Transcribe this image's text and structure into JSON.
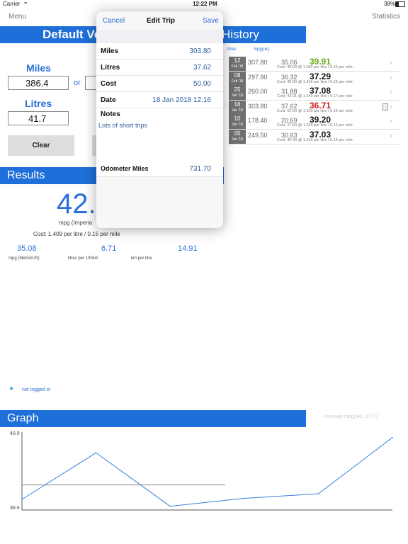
{
  "status": {
    "carrier": "Carrier",
    "time": "12:22 PM",
    "battery": "38%"
  },
  "topbar": {
    "menu": "Menu",
    "statistics": "Statistics"
  },
  "calculator": {
    "title": "Default Ve",
    "miles_label": "Miles",
    "miles_value": "386.4",
    "or_label": "or",
    "litres_label": "Litres",
    "litres_value": "41.7",
    "clear_label": "Clear"
  },
  "results": {
    "title": "Results",
    "big_value": "42.",
    "big_unit": "mpg (Imperia",
    "cost_line": "Cost: 1.409 per litre / 0.15 per mile",
    "metrics": [
      {
        "value": "35.08",
        "label": "mpg (Metric/US)"
      },
      {
        "value": "6.71",
        "label": "litres per 100km"
      },
      {
        "value": "14.91",
        "label": "km per litre"
      }
    ]
  },
  "twitter": {
    "status": "not logged in"
  },
  "history": {
    "title": "History",
    "col_litres": "litres",
    "col_mpg": "mpg(uk)",
    "rows": [
      {
        "day": "12",
        "month": "Feb '18",
        "miles": "307.80",
        "litres": "35.06",
        "mpg": "39.91",
        "mpg_color": "#6aa51c",
        "cost": "Cost: 48.00 @ 1.369 per litre / 0.16 per mile",
        "note": false
      },
      {
        "day": "08",
        "month": "Feb '18",
        "miles": "297.90",
        "litres": "36.32",
        "mpg": "37.29",
        "mpg_color": "#111111",
        "cost": "Cost: 49.00 @ 1.349 per litre / 0.16 per mile",
        "note": false
      },
      {
        "day": "25",
        "month": "Jan '18",
        "miles": "260.00",
        "litres": "31.88",
        "mpg": "37.08",
        "mpg_color": "#111111",
        "cost": "Cost: 43.01 @ 1.349 per litre / 0.17 per mile",
        "note": false
      },
      {
        "day": "18",
        "month": "Jan '18",
        "miles": "303.80",
        "litres": "37.62",
        "mpg": "36.71",
        "mpg_color": "#d01c1c",
        "cost": "Cost: 50.00 @ 1.329 per litre / 0.16 per mile",
        "note": true
      },
      {
        "day": "10",
        "month": "Jan '18",
        "miles": "178.40",
        "litres": "20.69",
        "mpg": "39.20",
        "mpg_color": "#111111",
        "cost": "Cost: 27.50 @ 1.329 per litre / 0.15 per mile",
        "note": false
      },
      {
        "day": "05",
        "month": "Jan '18",
        "miles": "249.50",
        "litres": "30.63",
        "mpg": "37.03",
        "mpg_color": "#111111",
        "cost": "Cost: 40.40 @ 1.319 per litre / 0.16 per mile",
        "note": false
      }
    ]
  },
  "graph": {
    "title": "Graph",
    "average_label": "Average mpg(uk): 37.70",
    "y_max_label": "40.0",
    "y_min_label": "36.6"
  },
  "chart_data": {
    "type": "line",
    "ylim": [
      36.6,
      40.0
    ],
    "series": [
      {
        "values": [
          37.03,
          39.2,
          36.71,
          37.08,
          37.29,
          39.91
        ]
      }
    ],
    "average": 37.7
  },
  "popover": {
    "cancel": "Cancel",
    "title": "Edit Trip",
    "save": "Save",
    "fields": [
      {
        "label": "Miles",
        "value": "303.80"
      },
      {
        "label": "Litres",
        "value": "37.62"
      },
      {
        "label": "Cost",
        "value": "50.00"
      },
      {
        "label": "Date",
        "value": "18 Jan 2018 12:16"
      }
    ],
    "notes_label": "Notes",
    "notes_value": "Lots of short trips",
    "odometer_label": "Odometer Miles",
    "odometer_value": "731.70"
  }
}
